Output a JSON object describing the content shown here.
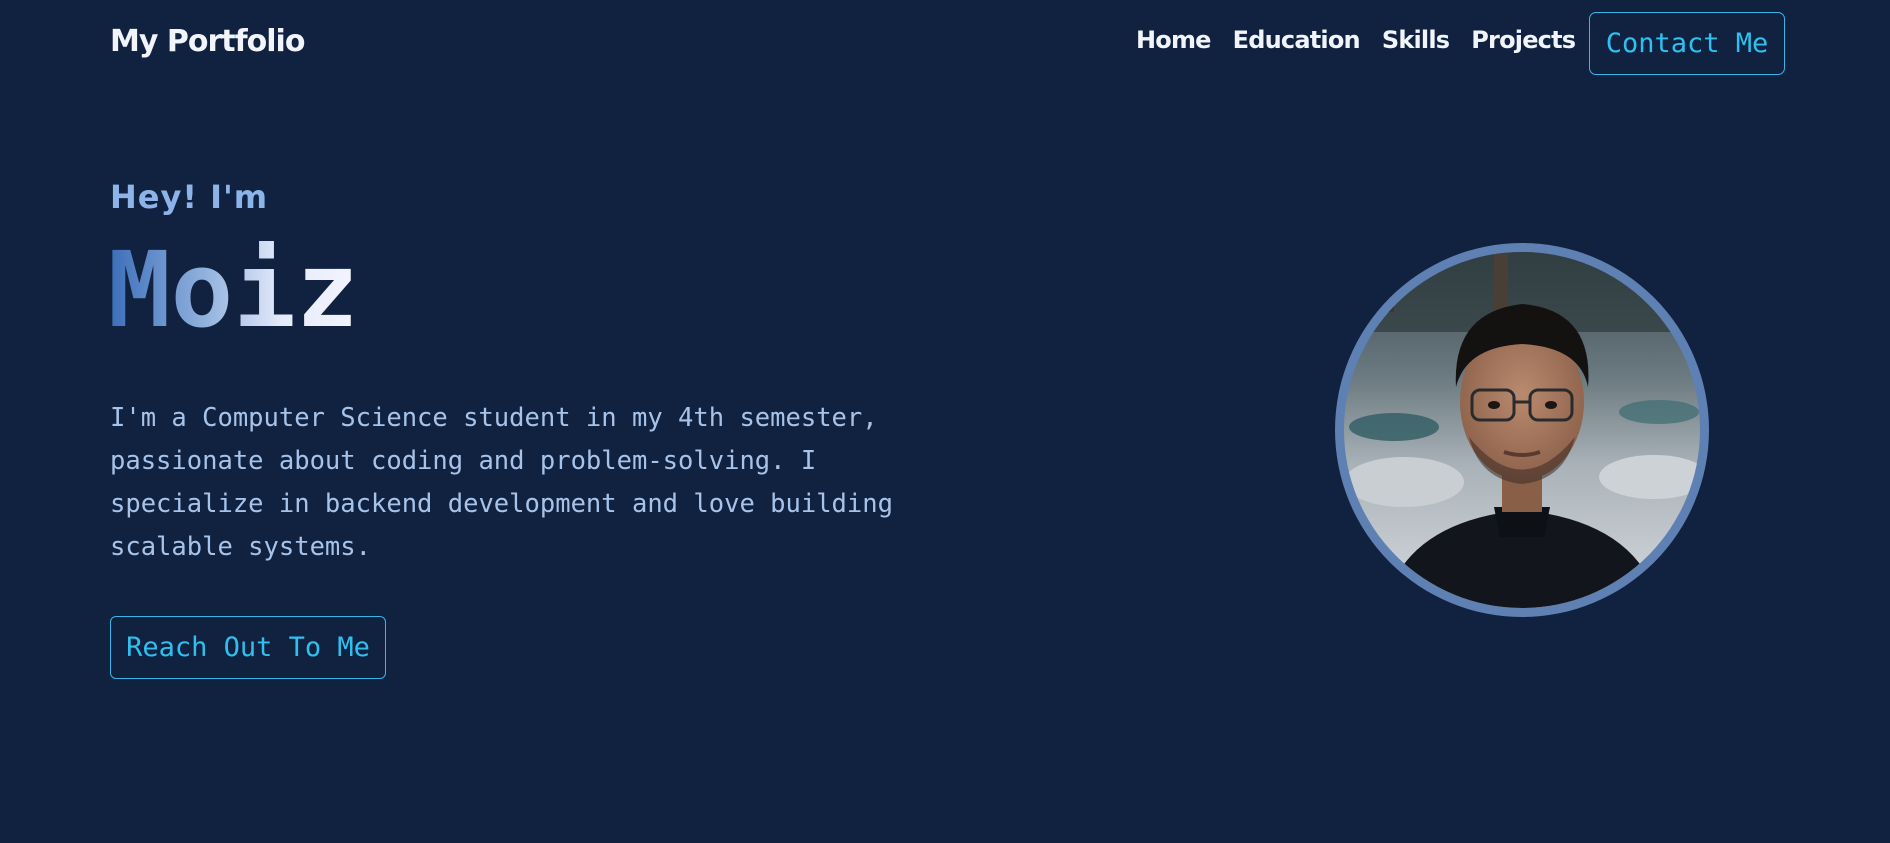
{
  "nav": {
    "brand": "My Portfolio",
    "links": [
      "Home",
      "Education",
      "Skills",
      "Projects"
    ],
    "contact_button": "Contact Me"
  },
  "hero": {
    "greeting": "Hey! I'm",
    "name": "Moiz",
    "bio": "I'm a Computer Science student in my 4th semester, passionate about coding and problem-solving. I specialize in backend development and love building scalable systems.",
    "cta_button": "Reach Out To Me"
  },
  "avatar": {
    "description_icon": "profile-photo"
  },
  "colors": {
    "background": "#112240",
    "accent": "#2fc0f0",
    "text_primary": "#f1f4fb",
    "text_secondary": "#a7c3ea",
    "avatar_ring": "#5f80b3"
  }
}
